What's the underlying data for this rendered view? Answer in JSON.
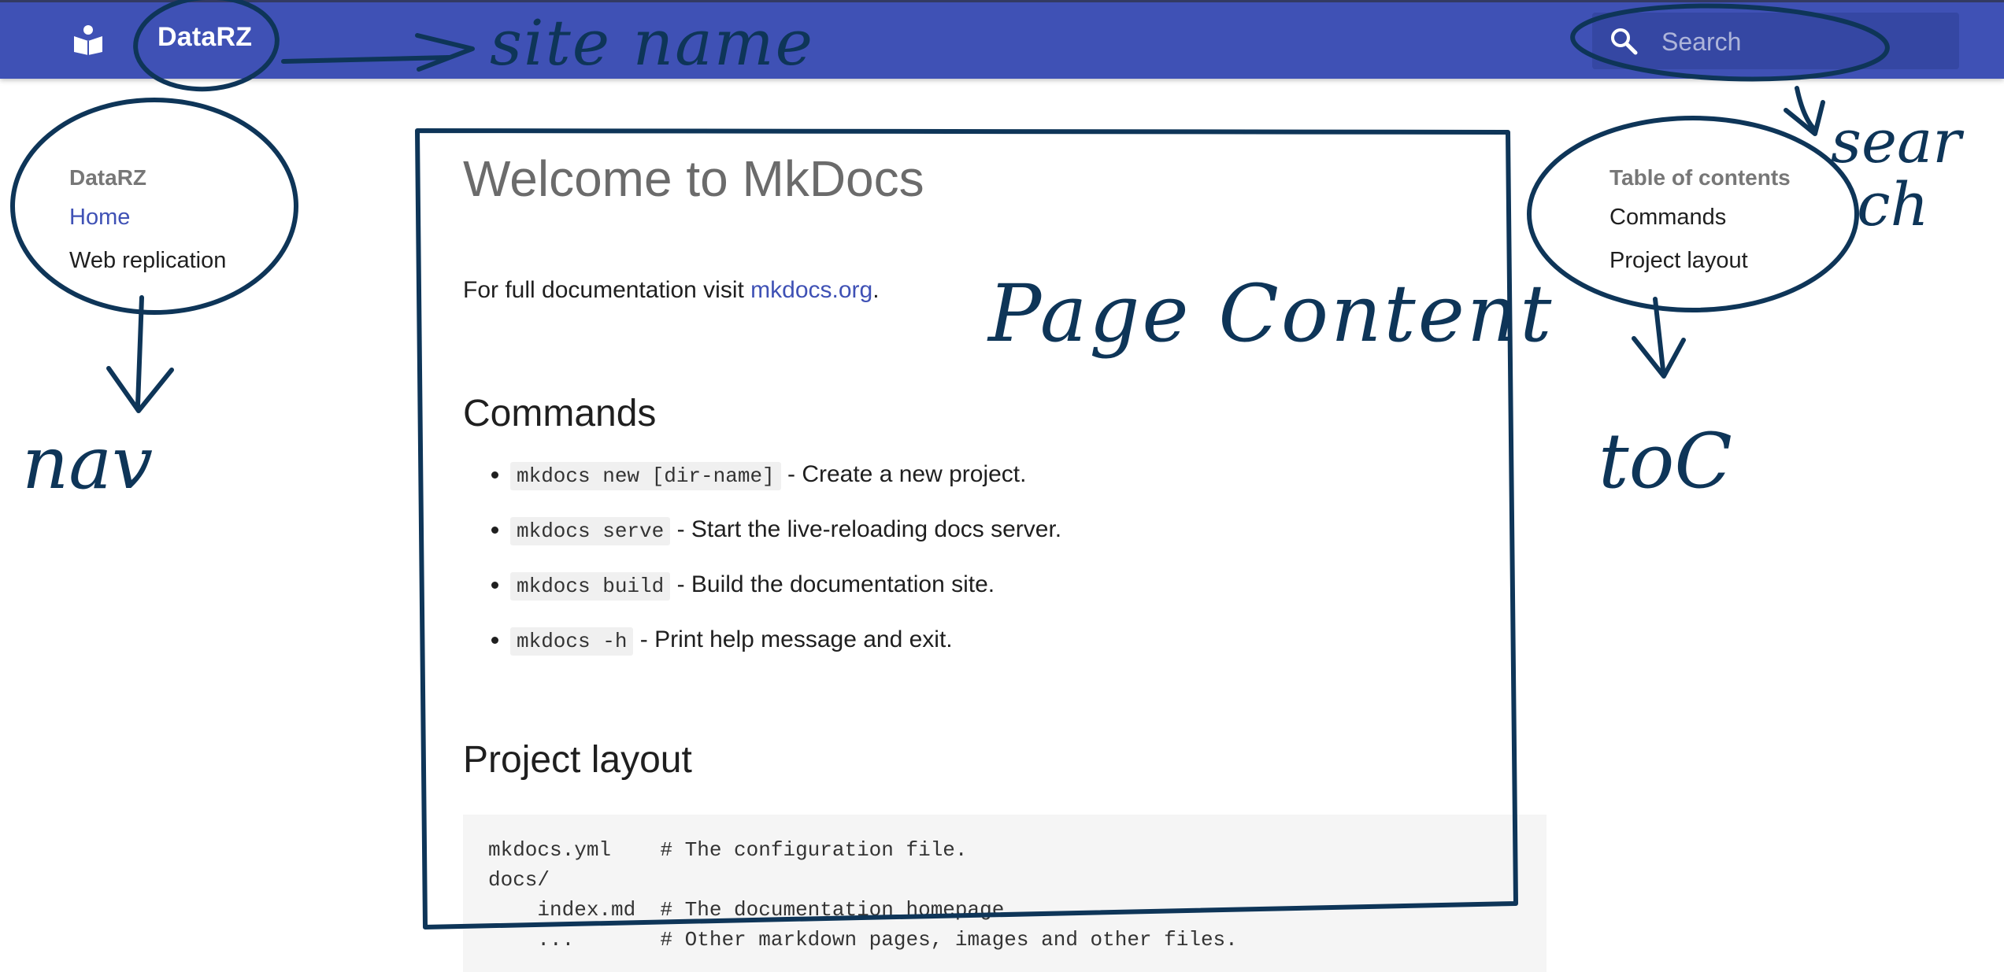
{
  "header": {
    "site_name": "DataRZ",
    "logo_icon": "book-reader-icon",
    "search_placeholder": "Search",
    "search_icon": "search-icon",
    "color": "#3f51b5"
  },
  "nav": {
    "title": "DataRZ",
    "items": [
      {
        "label": "Home",
        "active": true
      },
      {
        "label": "Web replication",
        "active": false
      }
    ]
  },
  "toc": {
    "title": "Table of contents",
    "items": [
      "Commands",
      "Project layout"
    ]
  },
  "content": {
    "title": "Welcome to MkDocs",
    "lead_text": "For full documentation visit ",
    "lead_link": "mkdocs.org",
    "lead_end": ".",
    "commands_heading": "Commands",
    "commands": [
      {
        "code": "mkdocs new [dir-name]",
        "text": " - Create a new project."
      },
      {
        "code": "mkdocs serve",
        "text": " - Start the live-reloading docs server."
      },
      {
        "code": "mkdocs build",
        "text": " - Build the documentation site."
      },
      {
        "code": "mkdocs -h",
        "text": " - Print help message and exit."
      }
    ],
    "layout_heading": "Project layout",
    "layout_lines": [
      "mkdocs.yml    # The configuration file.",
      "docs/",
      "    index.md  # The documentation homepage.",
      "    ...       # Other markdown pages, images and other files."
    ]
  },
  "annotations": {
    "site_name": "site name",
    "search_1": "sear",
    "search_2": "ch",
    "page_content": "Page Content",
    "nav": "nav",
    "toc": "toC",
    "ink_color": "#0e3558"
  }
}
